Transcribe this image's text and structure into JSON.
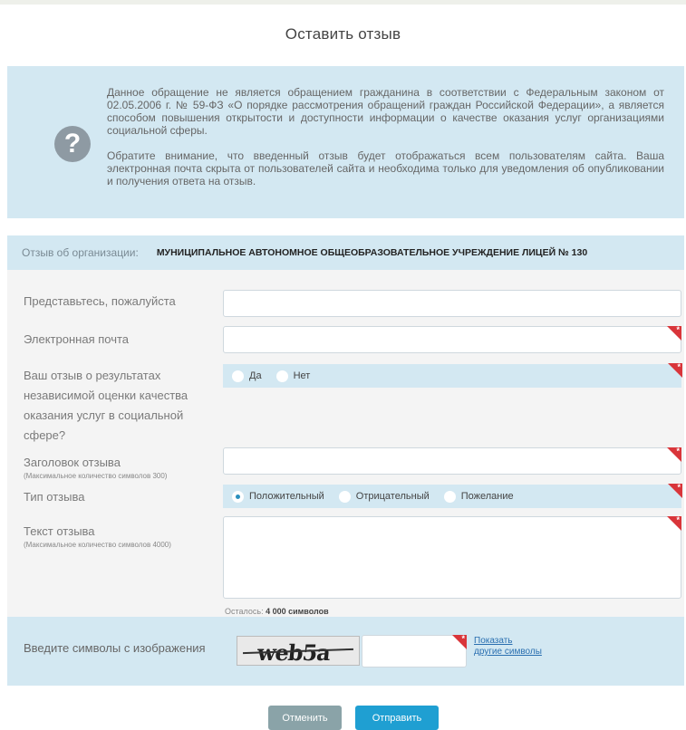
{
  "title": "Оставить отзыв",
  "info": {
    "paragraph1": "Данное обращение не является обращением гражданина в соответствии с Федеральным законом от 02.05.2006 г. № 59-ФЗ «О порядке рассмотрения обращений граждан Российской Федерации», а является способом повышения открытости и доступности информации о качестве оказания услуг организациями социальной сферы.",
    "paragraph2": "Обратите внимание, что введенный отзыв будет отображаться всем пользователям сайта. Ваша электронная почта скрыта от пользователей сайта и необходима только для уведомления об опубликовании и получения ответа на отзыв."
  },
  "organization": {
    "label": "Отзыв об организации:",
    "name": "МУНИЦИПАЛЬНОЕ АВТОНОМНОЕ ОБЩЕОБРАЗОВАТЕЛЬНОЕ УЧРЕЖДЕНИЕ ЛИЦЕЙ № 130"
  },
  "form": {
    "name_label": "Представьтесь, пожалуйста",
    "name_value": "",
    "email_label": "Электронная почта",
    "email_value": "",
    "independent_label": "Ваш отзыв о результатах независимой оценки качества оказания услуг в социальной сфере?",
    "independent_options": [
      "Да",
      "Нет"
    ],
    "subject_label": "Заголовок отзыва",
    "subject_hint": "(Максимальное количество символов 300)",
    "subject_value": "",
    "type_label": "Тип отзыва",
    "type_options": [
      "Положительный",
      "Отрицательный",
      "Пожелание"
    ],
    "type_selected": "Положительный",
    "text_label": "Текст отзыва",
    "text_hint": "(Максимальное количество символов 4000)",
    "text_value": "",
    "counter_prefix": "Осталось:",
    "counter_value": "4 000 символов"
  },
  "captcha": {
    "label": "Введите символы с изображения",
    "image_text": "web5a",
    "input_value": "",
    "link_line1": "Показать",
    "link_line2": "другие символы"
  },
  "buttons": {
    "cancel": "Отменить",
    "submit": "Отправить"
  },
  "colors": {
    "panel_bg": "#d3e8f2",
    "required_marker": "#d9353a",
    "submit": "#1f9fd2",
    "cancel": "#8aa3a8"
  }
}
